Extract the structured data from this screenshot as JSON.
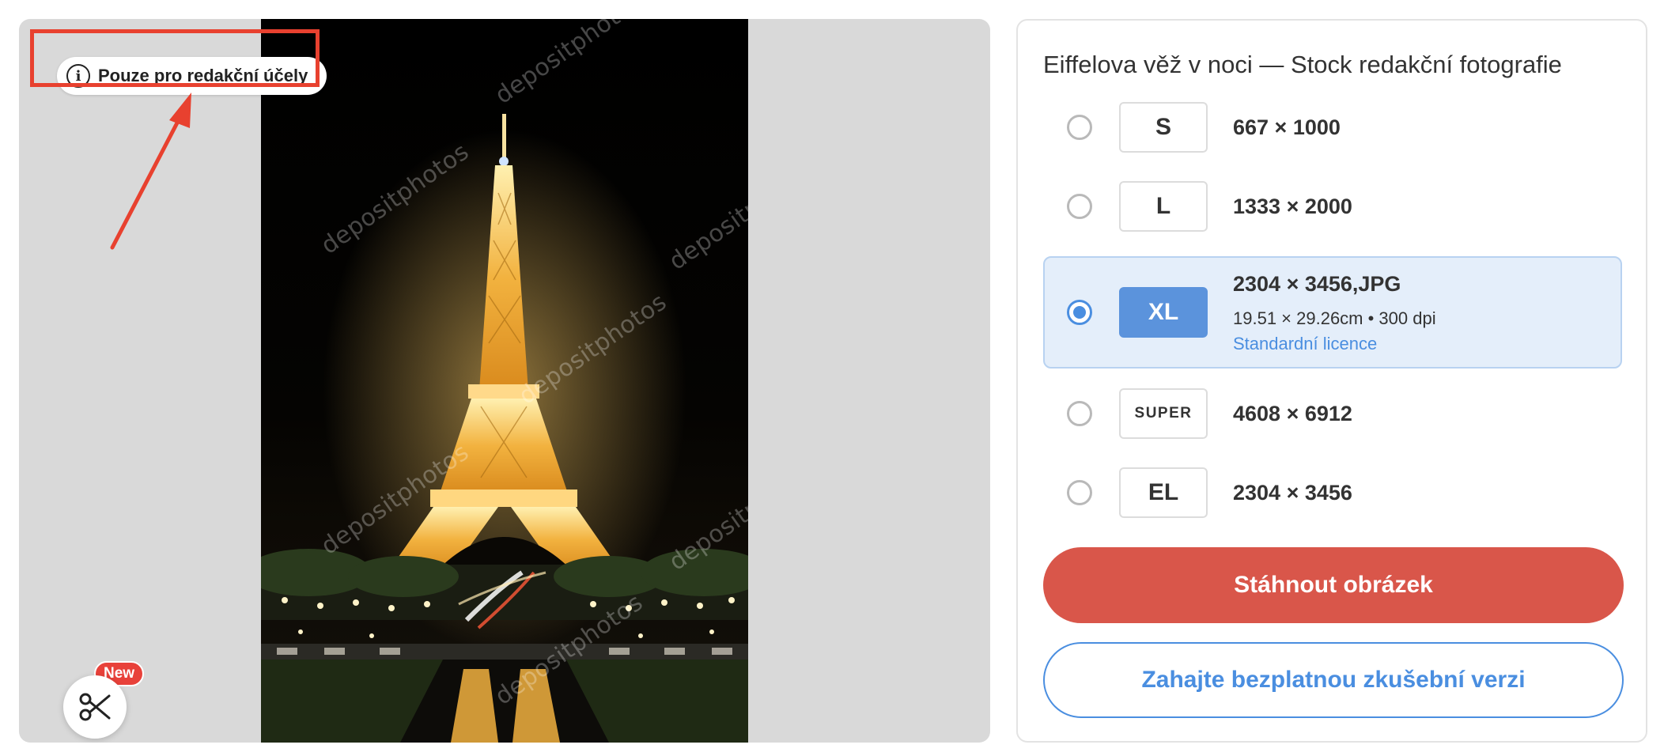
{
  "preview": {
    "editorial_badge": {
      "icon": "info-icon",
      "label": "Pouze pro redakční účely"
    },
    "watermark_text": "depositphotos",
    "scissors_button": {
      "icon": "scissors-icon",
      "badge": "New"
    },
    "annotation_color": "#e8412f"
  },
  "panel": {
    "title": "Eiffelova věž v noci — Stock redakční fotografie",
    "options": [
      {
        "code": "S",
        "dims": "667 × 1000",
        "selected": false
      },
      {
        "code": "L",
        "dims": "1333 × 2000",
        "selected": false
      },
      {
        "code": "XL",
        "dims": "2304 × 3456,JPG",
        "print": "19.51 × 29.26cm • 300 dpi",
        "license": "Standardní licence",
        "selected": true
      },
      {
        "code": "SUPER",
        "dims": "4608 × 6912",
        "selected": false
      },
      {
        "code": "EL",
        "dims": "2304 × 3456",
        "selected": false
      }
    ],
    "download_label": "Stáhnout obrázek",
    "trial_label": "Zahajte bezplatnou zkušební verzi"
  },
  "colors": {
    "accent_blue": "#4a8ee0",
    "download_red": "#d9564a",
    "selected_bg": "#e4eefa"
  }
}
